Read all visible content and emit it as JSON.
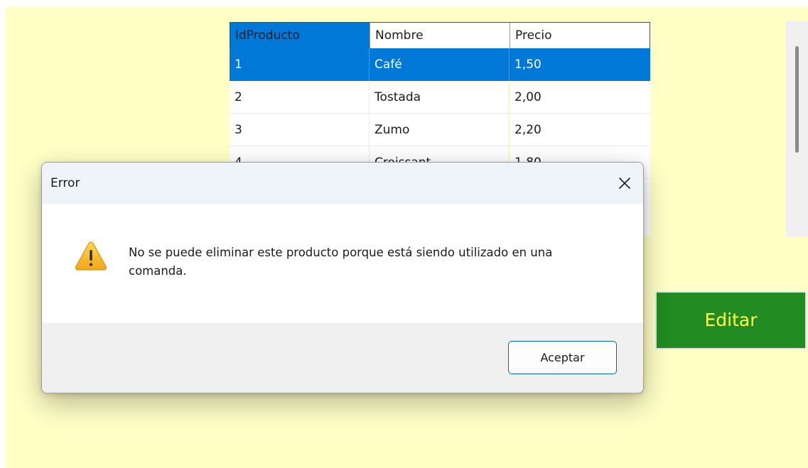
{
  "grid": {
    "columns": [
      "IdProducto",
      "Nombre",
      "Precio"
    ],
    "rows": [
      [
        "1",
        "Café",
        "1,50"
      ],
      [
        "2",
        "Tostada",
        "2,00"
      ],
      [
        "3",
        "Zumo",
        "2,20"
      ],
      [
        "4",
        "Croissant",
        "1,80"
      ]
    ],
    "selected_row": 0
  },
  "buttons": {
    "edit_label": "Editar"
  },
  "dialog": {
    "title": "Error",
    "icon": "warning-icon",
    "message": "No se puede eliminar este producto porque está siendo utilizado en una comanda.",
    "ok_label": "Aceptar"
  },
  "colors": {
    "app_background": "#ffffc6",
    "selection": "#0078d7",
    "edit_button_bg": "#228b22",
    "edit_button_text": "#ffff4a",
    "warning_icon": "#f2b31b"
  }
}
